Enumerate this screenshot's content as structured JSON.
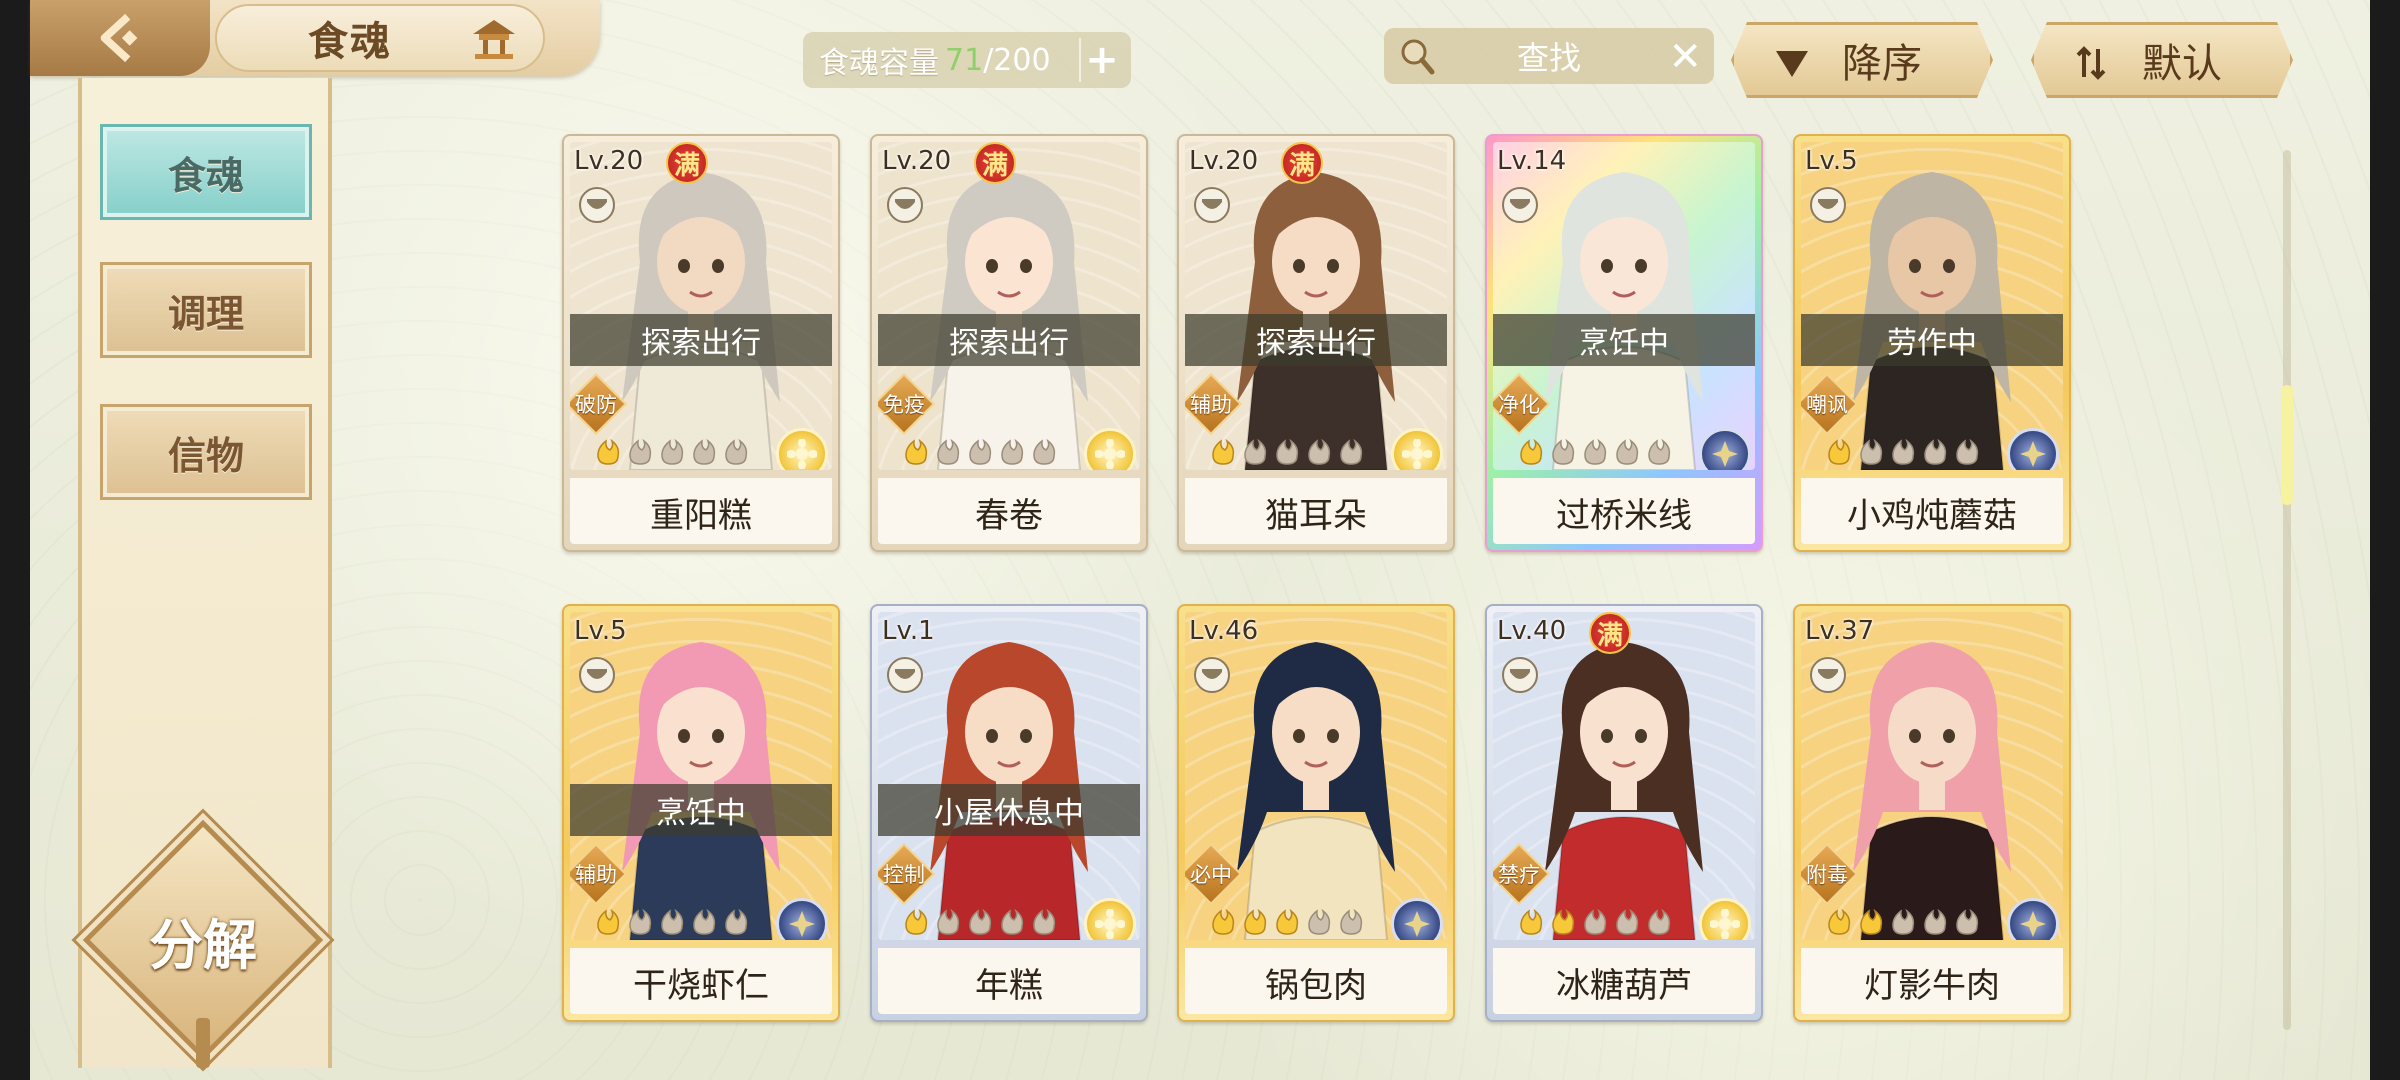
{
  "header": {
    "title": "食魂",
    "capacity_label": "食魂容量",
    "capacity_current": "71",
    "capacity_max": "/200",
    "search_placeholder": "查找",
    "sort_order_label": "降序",
    "sort_mode_label": "默认"
  },
  "sidebar": {
    "items": [
      {
        "label": "食魂",
        "active": true
      },
      {
        "label": "调理",
        "active": false
      },
      {
        "label": "信物",
        "active": false
      }
    ],
    "decompose_label": "分解"
  },
  "colors": {
    "accent_teal": "#85cfca",
    "gold": "#f5c95b",
    "capacity_green": "#8fd06a",
    "full_badge_red": "#d0302a"
  },
  "full_badge_text": "满",
  "cards": [
    {
      "level": "Lv.20",
      "full": true,
      "status": "探索出行",
      "role": "破防",
      "stars": 1,
      "element": "sun",
      "name": "重阳糕",
      "rarity": "beige",
      "hair": "#cfc8bf",
      "skin": "#f2d9c2",
      "cloth": "#efe9d8",
      "bg": "#efe4cf"
    },
    {
      "level": "Lv.20",
      "full": true,
      "status": "探索出行",
      "role": "免疫",
      "stars": 1,
      "element": "sun",
      "name": "春卷",
      "rarity": "beige",
      "hair": "#cfcac2",
      "skin": "#fbe5d2",
      "cloth": "#f7f3ea",
      "bg": "#eee3cd"
    },
    {
      "level": "Lv.20",
      "full": true,
      "status": "探索出行",
      "role": "辅助",
      "stars": 1,
      "element": "sun",
      "name": "猫耳朵",
      "rarity": "beige",
      "hair": "#8d5f3c",
      "skin": "#f6dcc4",
      "cloth": "#3d2f2a",
      "bg": "#efe4cf"
    },
    {
      "level": "Lv.14",
      "full": false,
      "status": "烹饪中",
      "role": "净化",
      "stars": 1,
      "element": "moon",
      "name": "过桥米线",
      "rarity": "rainbow",
      "hair": "#dfe4de",
      "skin": "#f9e6d6",
      "cloth": "#f6f2e4",
      "bg": "#f8e7c6"
    },
    {
      "level": "Lv.5",
      "full": false,
      "status": "劳作中",
      "role": "嘲讽",
      "stars": 1,
      "element": "moon",
      "name": "小鸡炖蘑菇",
      "rarity": "gold",
      "hair": "#bfb5a4",
      "skin": "#e8c7a6",
      "cloth": "#2c2522",
      "bg": "#f6d281"
    },
    {
      "level": "Lv.5",
      "full": false,
      "status": "烹饪中",
      "role": "辅助",
      "stars": 1,
      "element": "moon",
      "name": "干烧虾仁",
      "rarity": "gold",
      "hair": "#f29ab4",
      "skin": "#fae0cf",
      "cloth": "#2d3b5a",
      "bg": "#f6d281"
    },
    {
      "level": "Lv.1",
      "full": false,
      "status": "小屋休息中",
      "role": "控制",
      "stars": 1,
      "element": "sun",
      "name": "年糕",
      "rarity": "silver",
      "hair": "#b8472b",
      "skin": "#f7dcc6",
      "cloth": "#b8272a",
      "bg": "#dbe2ef"
    },
    {
      "level": "Lv.46",
      "full": false,
      "status": "",
      "role": "必中",
      "stars": 3,
      "element": "moon",
      "name": "锅包肉",
      "rarity": "gold",
      "hair": "#1f2a44",
      "skin": "#f7dcc6",
      "cloth": "#f3e4c0",
      "bg": "#f6d281"
    },
    {
      "level": "Lv.40",
      "full": true,
      "status": "",
      "role": "禁疗",
      "stars": 2,
      "element": "sun",
      "name": "冰糖葫芦",
      "rarity": "silver",
      "hair": "#4a2f22",
      "skin": "#f9e1cf",
      "cloth": "#c22c2c",
      "bg": "#dbe2ef"
    },
    {
      "level": "Lv.37",
      "full": false,
      "status": "",
      "role": "附毒",
      "stars": 2,
      "element": "moon",
      "name": "灯影牛肉",
      "rarity": "gold",
      "hair": "#f0a0a8",
      "skin": "#f6dcc8",
      "cloth": "#2a1a1a",
      "bg": "#f6d281"
    }
  ]
}
